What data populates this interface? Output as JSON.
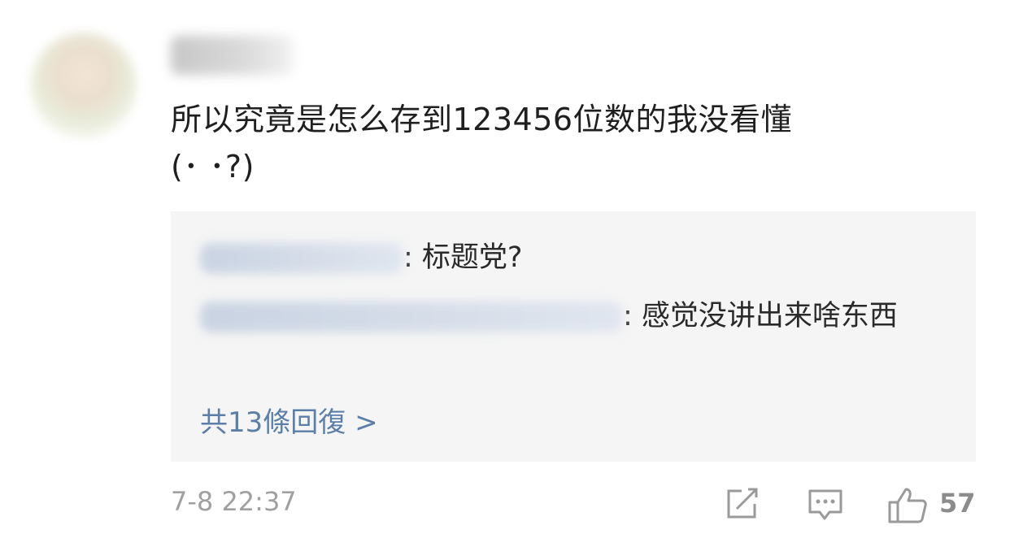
{
  "comment": {
    "text_line1": "所以究竟是怎么存到123456位数的我没看懂",
    "text_line2": "(･ ･?)"
  },
  "replies": [
    {
      "text": "标题党?"
    },
    {
      "text": "感觉没讲出来啥东西"
    }
  ],
  "more_replies_label": "共13條回復 >",
  "timestamp": "7-8 22:37",
  "like_count": "57",
  "icons": {
    "share": "share-icon",
    "reply": "reply-icon",
    "like": "like-icon"
  }
}
